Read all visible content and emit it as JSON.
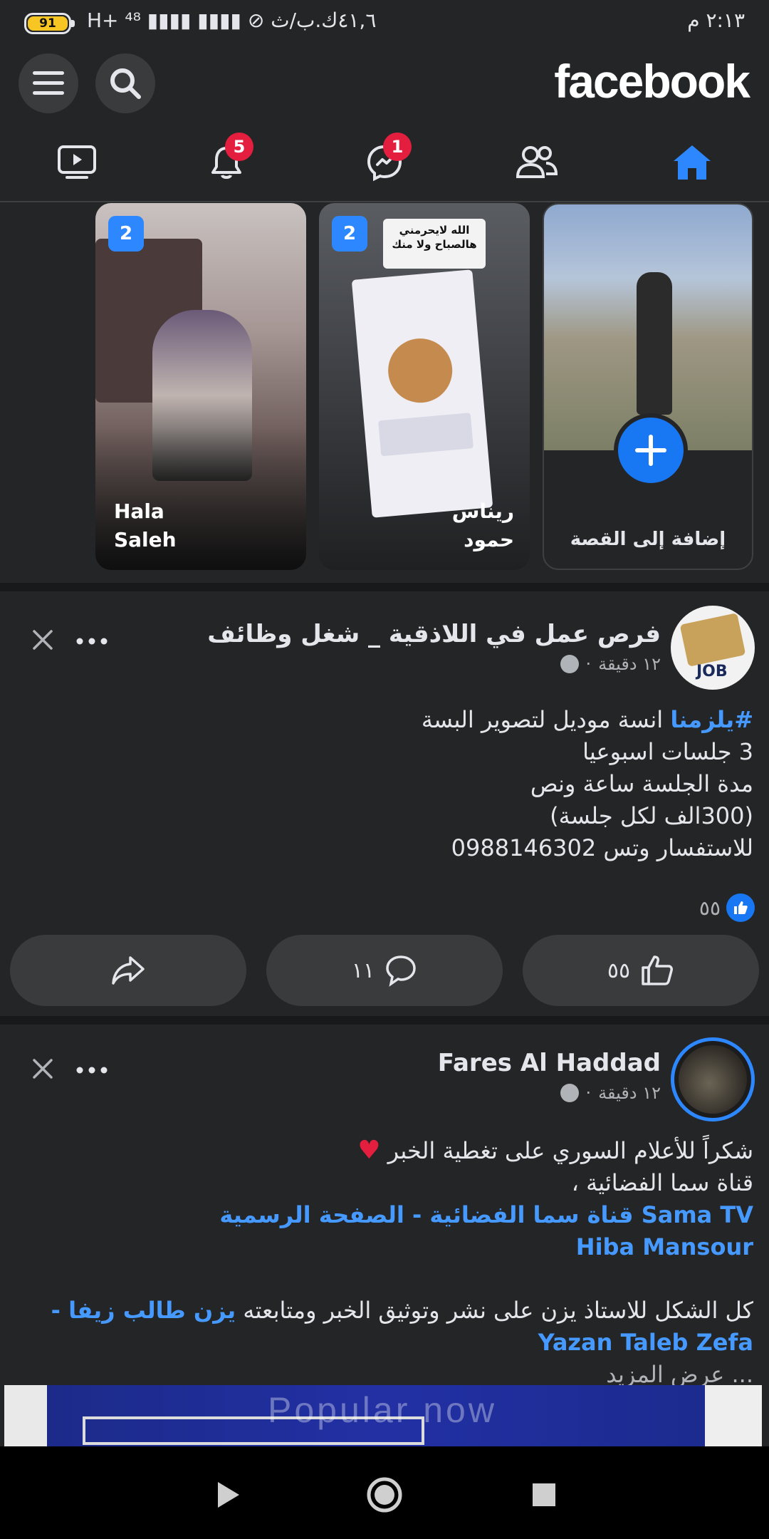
{
  "status_bar": {
    "battery": "91",
    "left_text": "H+ ⁴⁸ ▮▮▮▮  ▮▮▮▮  ⊘ ٤١,٦ك.ب/ث",
    "right_text": "٢:١٣ م"
  },
  "header": {
    "logo": "facebook"
  },
  "nav": {
    "notifications_badge": "5",
    "messenger_badge": "1"
  },
  "stories": [
    {
      "name_line1": "Hala",
      "name_line2": "Saleh",
      "count": "2"
    },
    {
      "name_line1": "ريناس",
      "name_line2": "حمود",
      "count": "2",
      "overlay_text": "الله لايحرمني هالصباح ولا منك"
    },
    {
      "add_label": "إضافة إلى القصة"
    }
  ],
  "post1": {
    "page_name": "فرص عمل في اللاذقية _ شغل وظائف",
    "time": "١٢ دقيقة",
    "hashtag": "#يلزمنا",
    "line1_rest": " انسة موديل لتصوير البسة",
    "line2": "3 جلسات اسبوعيا",
    "line3": "مدة الجلسة ساعة ونص",
    "line4": "(300الف لكل جلسة)",
    "line5": "للاستفسار وتس 0988146302",
    "reaction_count": "٥٥",
    "like_count": "٥٥",
    "comment_count": "١١"
  },
  "post2": {
    "author": "Fares Al Haddad",
    "time": "١٢ دقيقة",
    "line1": "شكراً للأعلام السوري على تغطية الخبر",
    "line2": "قناة سما الفضائية ،",
    "link1": "Sama TV  قناة سما الفضائية - الصفحة الرسمية",
    "link2": "Hiba Mansour",
    "line3_text": "كل الشكل للاستاذ يزن على نشر وتوثيق الخبر ومتابعته ",
    "link3": "يزن طالب زيفا - Yazan Taleb Zefa",
    "see_more": "... عرض المزيد",
    "video_text": "Popular now"
  },
  "colors": {
    "background": "#242526",
    "accent": "#1877f2",
    "link": "#4599ff",
    "badge": "#e41e3f"
  }
}
